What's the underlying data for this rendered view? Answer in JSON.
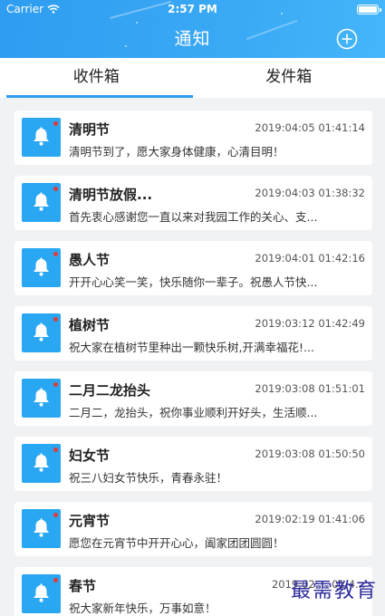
{
  "status": {
    "carrier": "Carrier",
    "time": "2:57 PM",
    "battery_level": 1.0
  },
  "header": {
    "title": "通知",
    "add_icon": "plus-circle-icon"
  },
  "tabs": [
    {
      "label": "收件箱",
      "active": true
    },
    {
      "label": "发件箱",
      "active": false
    }
  ],
  "notices": [
    {
      "title": "清明节",
      "date": "2019:04:05 01:41:14",
      "body": "清明节到了，愿大家身体健康，心清目明！"
    },
    {
      "title": "清明节放假...",
      "date": "2019:04:03 01:38:32",
      "body": "首先衷心感谢您一直以来对我园工作的关心、支..."
    },
    {
      "title": "愚人节",
      "date": "2019:04:01 01:42:16",
      "body": "开开心心笑一笑，快乐随你一辈子。祝愚人节快..."
    },
    {
      "title": "植树节",
      "date": "2019:03:12 01:42:49",
      "body": "祝大家在植树节里种出一颗快乐树,开满幸福花!..."
    },
    {
      "title": "二月二龙抬头",
      "date": "2019:03:08 01:51:01",
      "body": "二月二，龙抬头，祝你事业顺利开好头，生活顺..."
    },
    {
      "title": "妇女节",
      "date": "2019:03:08 01:50:50",
      "body": "祝三八妇女节快乐，青春永驻！"
    },
    {
      "title": "元宵节",
      "date": "2019:02:19 01:41:06",
      "body": "愿您在元宵节中开开心心，阖家团团圆圆！"
    },
    {
      "title": "春节",
      "date": "2019:02:... 01:4...",
      "body": "祝大家新年快乐，万事如意！"
    }
  ],
  "watermark": "最需教育",
  "colors": {
    "header": "#2f9df0",
    "icon_bg": "#2aa7f3",
    "badge": "#e53935",
    "page_bg": "#f1f2f4"
  }
}
